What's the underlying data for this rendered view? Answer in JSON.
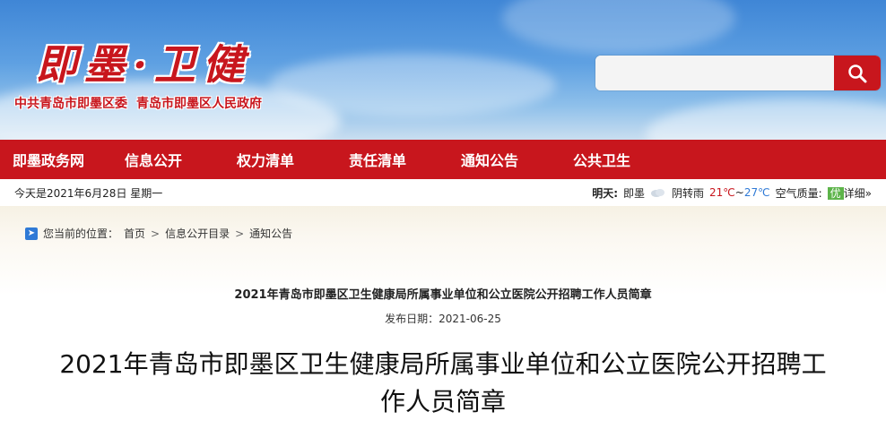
{
  "header": {
    "logo": "即墨·卫健",
    "sub_left": "中共青岛市即墨区委",
    "sub_right": "青岛市即墨区人民政府",
    "search_placeholder": "",
    "brand_color": "#c8161d"
  },
  "nav": {
    "items": [
      {
        "label": "即墨政务网"
      },
      {
        "label": "信息公开"
      },
      {
        "label": "权力清单"
      },
      {
        "label": "责任清单"
      },
      {
        "label": "通知公告"
      },
      {
        "label": "公共卫生"
      }
    ]
  },
  "infobar": {
    "date": "今天是2021年6月28日 星期一",
    "tomorrow_label": "明天:",
    "city": "即墨",
    "condition": "阴转雨",
    "temp_high": "21℃",
    "temp_sep": "~",
    "temp_low": "27℃",
    "air_label": "空气质量:",
    "air_value": "优",
    "detail": "详细»"
  },
  "breadcrumb": {
    "prefix": "您当前的位置：",
    "items": [
      "首页",
      "信息公开目录",
      "通知公告"
    ],
    "sep": ">"
  },
  "article": {
    "small_title": "2021年青岛市即墨区卫生健康局所属事业单位和公立医院公开招聘工作人员简章",
    "pubdate": "发布日期：2021-06-25",
    "big_title": "2021年青岛市即墨区卫生健康局所属事业单位和公立医院公开招聘工作人员简章"
  }
}
